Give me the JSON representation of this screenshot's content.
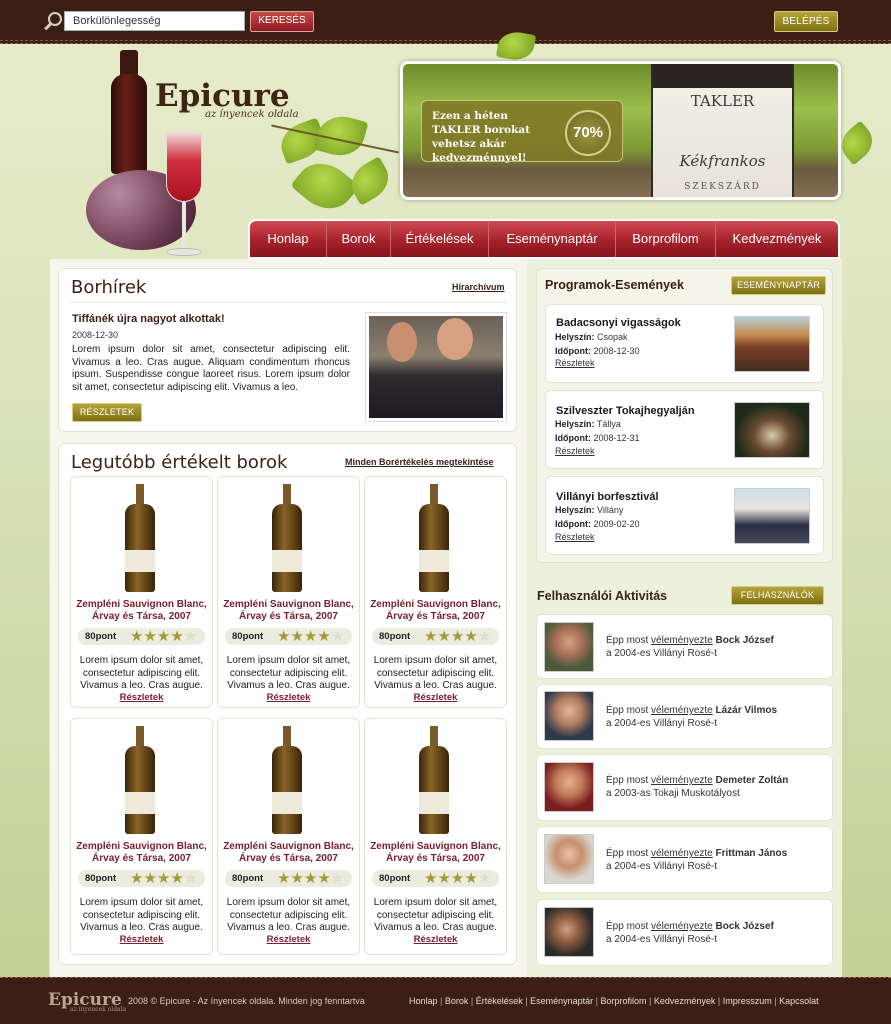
{
  "search": {
    "value": "Borkülönlegesség",
    "button": "KERESÉS"
  },
  "login_button": "BELÉPÉS",
  "logo": {
    "title": "Epicure",
    "subtitle": "az ínyencek oldala"
  },
  "banner": {
    "promo_text": "Ezen a héten TAKLER borokat vehetsz akár kedvezménnyel!",
    "discount": "70%",
    "label_brand": "TAKLER",
    "label_wine": "Kékfrankos",
    "label_region": "SZEKSZÁRD"
  },
  "nav": [
    "Honlap",
    "Borok",
    "Értékelések",
    "Eseménynaptár",
    "Borprofilom",
    "Kedvezmények"
  ],
  "news": {
    "title": "Borhírek",
    "archive_link": "Hírarchívum",
    "headline": "Tiffánék újra nagyot alkottak!",
    "date": "2008-12-30",
    "body": "Lorem ipsum dolor sit amet, consectetur adipiscing elit. Vivamus a leo. Cras augue. Aliquam condimentum rhoncus ipsum. Suspendisse congue laoreet risus. Lorem ipsum dolor sit amet, consectetur adipiscing elit. Vivamus a leo.",
    "button": "RÉSZLETEK"
  },
  "rated": {
    "title": "Legutóbb értékelt borok",
    "all_link": "Minden Borértékelés megtekintése",
    "wines": [
      {
        "name": "Zempléni Sauvignon Blanc, Árvay és Társa, 2007",
        "score": "80pont",
        "stars": 4,
        "desc": "Lorem ipsum dolor sit amet, consectetur adipiscing elit. Vivamus a leo. Cras augue.",
        "link": "Részletek"
      },
      {
        "name": "Zempléni Sauvignon Blanc, Árvay és Társa, 2007",
        "score": "80pont",
        "stars": 4,
        "desc": "Lorem ipsum dolor sit amet, consectetur adipiscing elit. Vivamus a leo. Cras augue.",
        "link": "Részletek"
      },
      {
        "name": "Zempléni Sauvignon Blanc, Árvay és Társa, 2007",
        "score": "80pont",
        "stars": 4,
        "desc": "Lorem ipsum dolor sit amet, consectetur adipiscing elit. Vivamus a leo. Cras augue.",
        "link": "Részletek"
      },
      {
        "name": "Zempléni Sauvignon Blanc, Árvay és Társa, 2007",
        "score": "80pont",
        "stars": 4,
        "desc": "Lorem ipsum dolor sit amet, consectetur adipiscing elit. Vivamus a leo. Cras augue.",
        "link": "Részletek"
      },
      {
        "name": "Zempléni Sauvignon Blanc, Árvay és Társa, 2007",
        "score": "80pont",
        "stars": 4,
        "desc": "Lorem ipsum dolor sit amet, consectetur adipiscing elit. Vivamus a leo. Cras augue.",
        "link": "Részletek"
      },
      {
        "name": "Zempléni Sauvignon Blanc, Árvay és Társa, 2007",
        "score": "80pont",
        "stars": 4,
        "desc": "Lorem ipsum dolor sit amet, consectetur adipiscing elit. Vivamus a leo. Cras augue.",
        "link": "Részletek"
      }
    ]
  },
  "events": {
    "title": "Programok-Események",
    "button": "ESEMÉNYNAPTÁR",
    "place_label": "Helyszín:",
    "time_label": "Időpont:",
    "items": [
      {
        "title": "Badacsonyi vigasságok",
        "place": "Csopak",
        "date": "2008-12-30",
        "link": "Részletek"
      },
      {
        "title": "Szilveszter Tokajhegyalján",
        "place": "Tállya",
        "date": "2008-12-31",
        "link": "Részletek"
      },
      {
        "title": "Villányi borfesztivál",
        "place": "Villány",
        "date": "2009-02-20",
        "link": "Részletek"
      }
    ]
  },
  "activity": {
    "title": "Felhasználói Aktivitás",
    "button": "FELHASZNÁLÓK",
    "prefix": "Épp most",
    "verb": "véleményezte",
    "items": [
      {
        "user": "Bock József",
        "wine": "a 2004-es Villányi Rosé-t"
      },
      {
        "user": "Lázár Vilmos",
        "wine": "a 2004-es Villányi Rosé-t"
      },
      {
        "user": "Demeter Zoltán",
        "wine": "a 2003-as Tokaji Muskotályost"
      },
      {
        "user": "Frittman János",
        "wine": "a 2004-es Villányi Rosé-t"
      },
      {
        "user": "Bock József",
        "wine": "a 2004-es Villányi Rosé-t"
      }
    ]
  },
  "footer": {
    "logo": "Epicure",
    "logo_sub": "az ínyencek oldala",
    "copyright": "2008 © Epicure - Az ínyencek oldala. Minden jog fenntartva",
    "links": [
      "Honlap",
      "Borok",
      "Értékelések",
      "Eseménynaptár",
      "Borprofilom",
      "Kedvezmények",
      "Impresszum",
      "Kapcsolat"
    ]
  }
}
